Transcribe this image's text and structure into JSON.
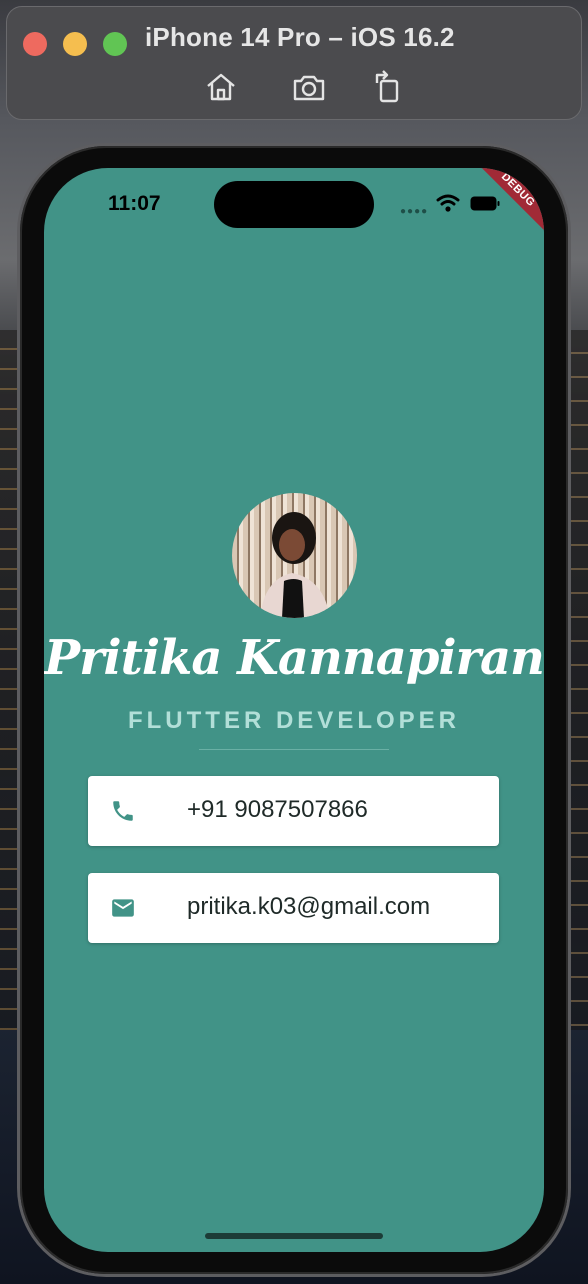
{
  "simulator": {
    "title": "iPhone 14 Pro – iOS 16.2",
    "traffic_lights": [
      "close",
      "minimize",
      "zoom"
    ],
    "toolbar_icons": [
      "home-icon",
      "screenshot-icon",
      "rotate-icon"
    ]
  },
  "status_bar": {
    "time": "11:07",
    "banner": "DEBUG"
  },
  "profile": {
    "name": "Pritika Kannapiran",
    "role": "FLUTTER DEVELOPER"
  },
  "contacts": {
    "phone": "+91 9087507866",
    "email": "pritika.k03@gmail.com"
  },
  "colors": {
    "background": "#419387",
    "accent": "#419387",
    "role_text": "#b2dfd8",
    "card": "#ffffff",
    "debug_banner": "#a12a36"
  }
}
